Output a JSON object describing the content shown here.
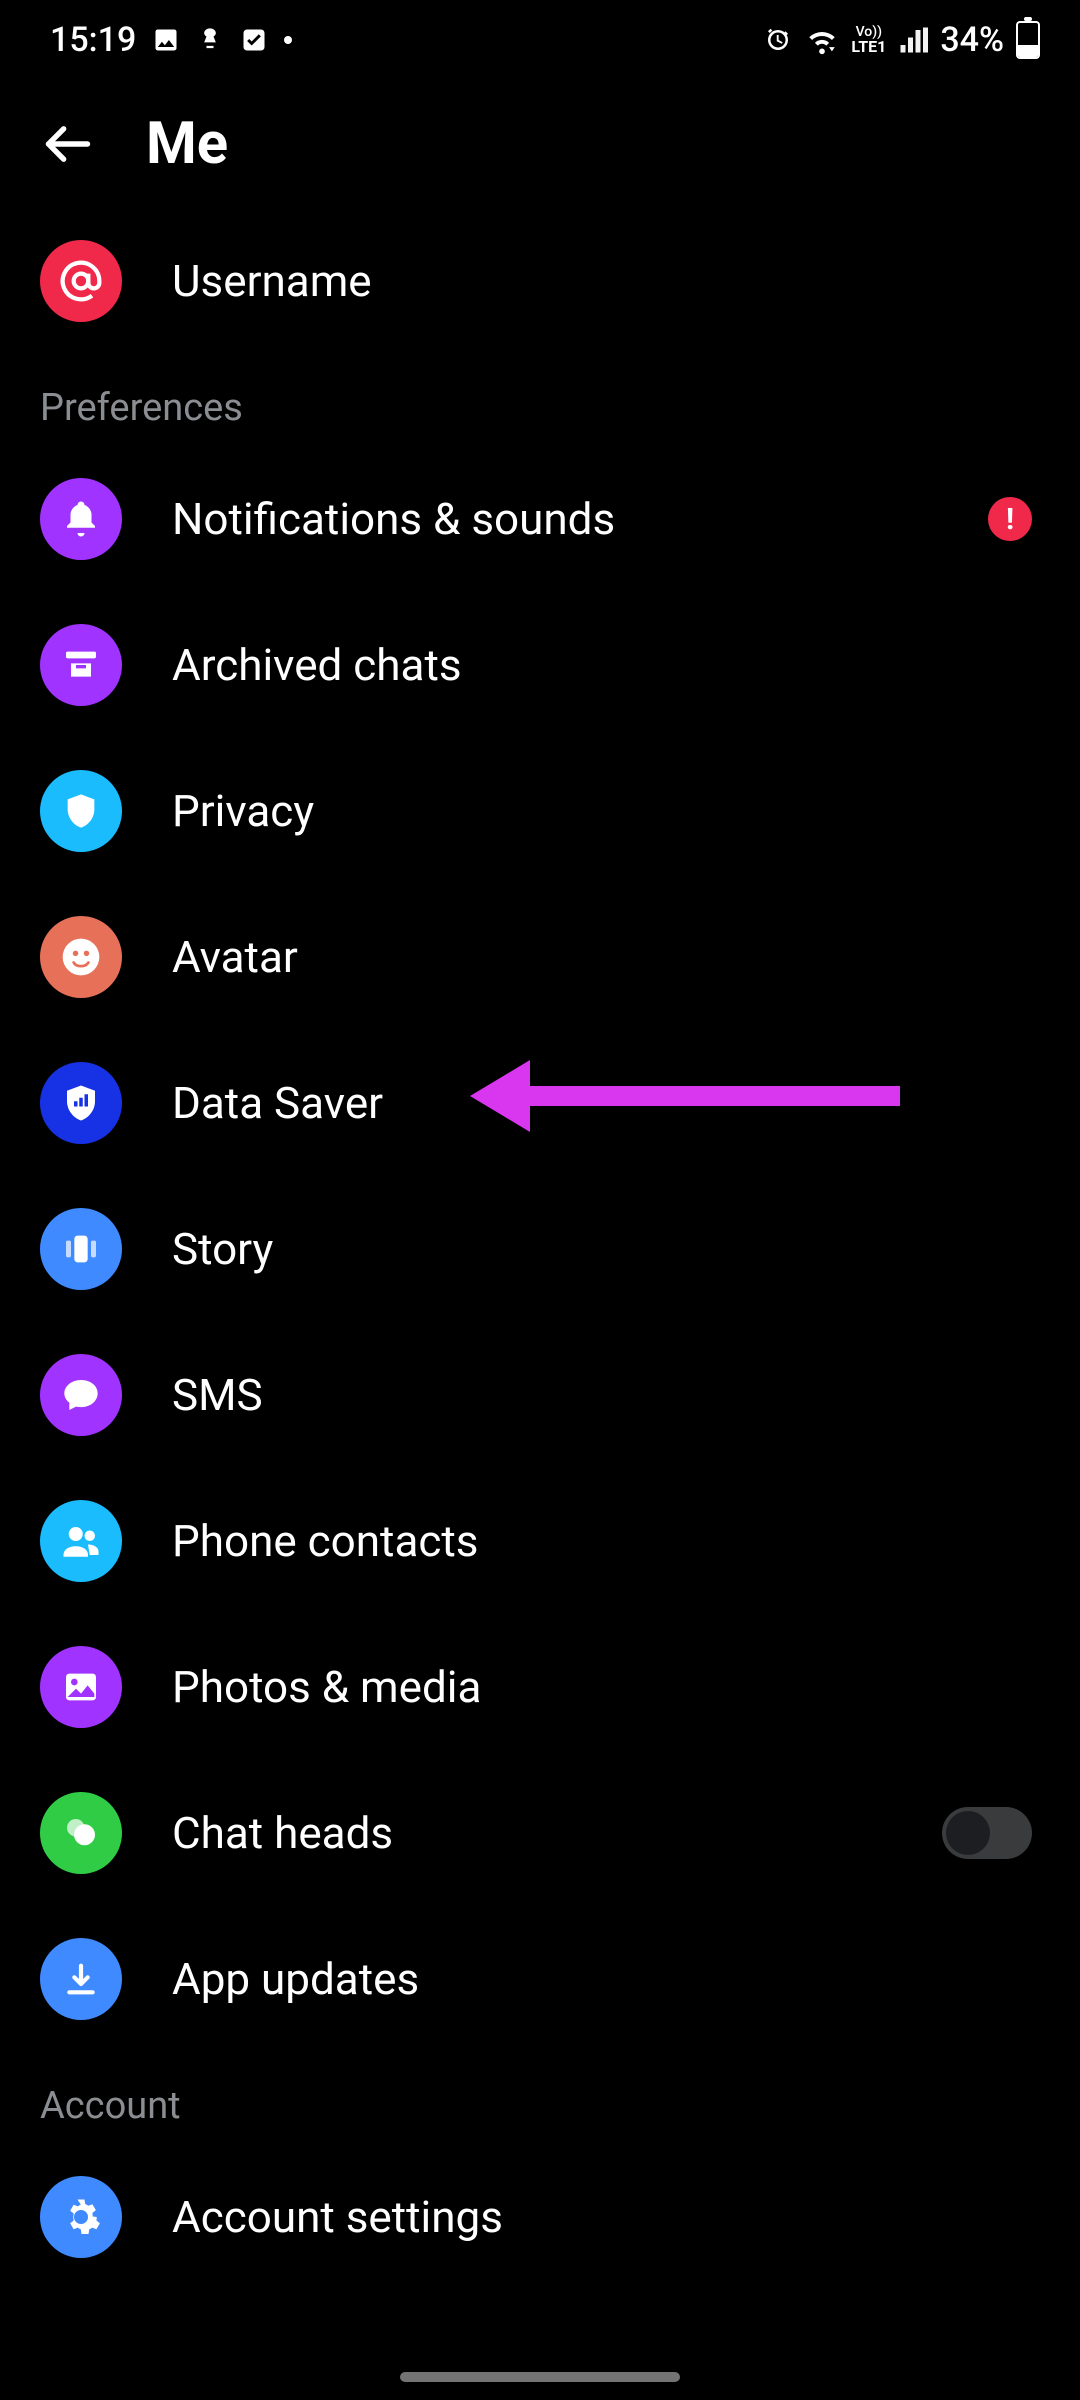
{
  "status": {
    "time": "15:19",
    "battery": "34%"
  },
  "header": {
    "title": "Me"
  },
  "top_items": [
    {
      "label": "Username",
      "icon": "at-icon",
      "color": "#f02849"
    }
  ],
  "sections": [
    {
      "title": "Preferences",
      "items": [
        {
          "label": "Notifications & sounds",
          "icon": "bell-icon",
          "color": "#a033ff",
          "alert": true
        },
        {
          "label": "Archived chats",
          "icon": "archive-icon",
          "color": "#a033ff"
        },
        {
          "label": "Privacy",
          "icon": "shield-icon",
          "color": "#1abcfe"
        },
        {
          "label": "Avatar",
          "icon": "face-icon",
          "color": "#e67158"
        },
        {
          "label": "Data Saver",
          "icon": "shield-chart-icon",
          "color": "#1732e5"
        },
        {
          "label": "Story",
          "icon": "panels-icon",
          "color": "#408aff"
        },
        {
          "label": "SMS",
          "icon": "chat-icon",
          "color": "#a033ff"
        },
        {
          "label": "Phone contacts",
          "icon": "people-icon",
          "color": "#1abcfe"
        },
        {
          "label": "Photos & media",
          "icon": "image-icon",
          "color": "#a033ff"
        },
        {
          "label": "Chat heads",
          "icon": "dots-icon",
          "color": "#31cc46",
          "toggle": false
        },
        {
          "label": "App updates",
          "icon": "download-icon",
          "color": "#408aff"
        }
      ]
    },
    {
      "title": "Account",
      "items": [
        {
          "label": "Account settings",
          "icon": "gear-icon",
          "color": "#408aff"
        }
      ]
    }
  ],
  "annotation_target": "Data Saver"
}
